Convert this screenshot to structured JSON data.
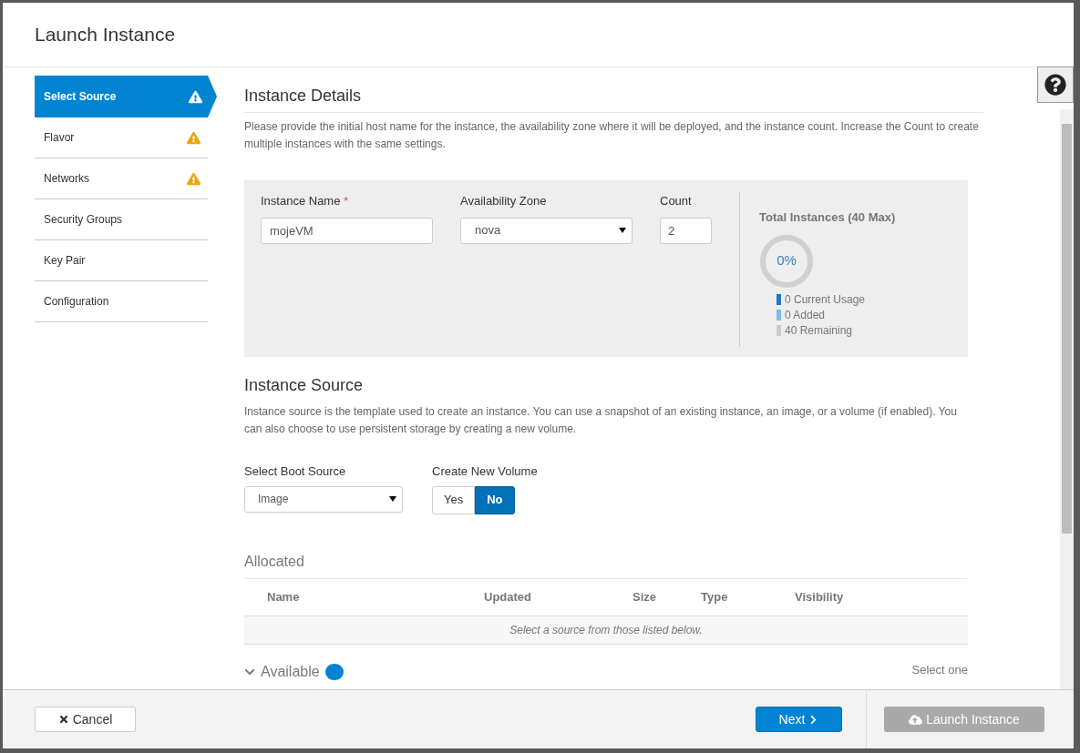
{
  "dialog": {
    "title": "Launch Instance"
  },
  "steps": [
    {
      "label": "Select Source",
      "selected": true,
      "warning": true
    },
    {
      "label": "Flavor",
      "selected": false,
      "warning": true
    },
    {
      "label": "Networks",
      "selected": false,
      "warning": true
    },
    {
      "label": "Security Groups",
      "selected": false,
      "warning": false
    },
    {
      "label": "Key Pair",
      "selected": false,
      "warning": false
    },
    {
      "label": "Configuration",
      "selected": false,
      "warning": false
    }
  ],
  "details": {
    "heading": "Instance Details",
    "description": "Please provide the initial host name for the instance, the availability zone where it will be deployed, and the instance count. Increase the Count to create multiple instances with the same settings.",
    "name_label": "Instance Name",
    "required_mark": "*",
    "name_value": "mojeVM",
    "zone_label": "Availability Zone",
    "zone_value": "nova",
    "count_label": "Count",
    "count_value": "2",
    "quota": {
      "title": "Total Instances (40 Max)",
      "percent": "0%",
      "legend": [
        {
          "text": "0 Current Usage",
          "color": "#1f78c1"
        },
        {
          "text": "0 Added",
          "color": "#7fbbe8"
        },
        {
          "text": "40 Remaining",
          "color": "#cccccc"
        }
      ]
    }
  },
  "source": {
    "heading": "Instance Source",
    "description": "Instance source is the template used to create an instance. You can use a snapshot of an existing instance, an image, or a volume (if enabled). You can also choose to use persistent storage by creating a new volume.",
    "boot_label": "Select Boot Source",
    "boot_value": "Image",
    "volume_label": "Create New Volume",
    "volume_options": [
      {
        "label": "Yes",
        "selected": false
      },
      {
        "label": "No",
        "selected": true
      }
    ]
  },
  "allocated": {
    "heading": "Allocated",
    "columns": [
      "Name",
      "Updated",
      "Size",
      "Type",
      "Visibility"
    ],
    "empty_text": "Select a source from those listed below."
  },
  "available": {
    "label": "Available",
    "hint": "Select one"
  },
  "footer": {
    "cancel": "Cancel",
    "next": "Next",
    "launch": "Launch Instance",
    "launch_disabled": true
  }
}
